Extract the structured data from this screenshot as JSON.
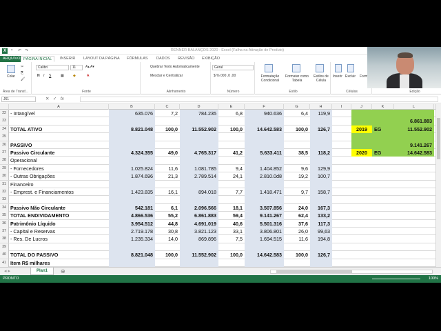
{
  "window": {
    "title": "RENNER BALANÇOS 2020 - Excel (Falha na Ativação de Produto)"
  },
  "ribbon_tabs": [
    "ARQUIVO",
    "PÁGINA INICIAL",
    "INSERIR",
    "LAYOUT DA PÁGINA",
    "FÓRMULAS",
    "DADOS",
    "REVISÃO",
    "EXIBIÇÃO"
  ],
  "ribbon": {
    "paste": "Colar",
    "font_name": "Calibri",
    "font_size": "11",
    "wrap_text": "Quebrar Texto Automaticamente",
    "merge_center": "Mesclar e Centralizar",
    "number_format": "Geral",
    "conditional_format": "Formatação Condicional",
    "format_table": "Formatar como Tabela",
    "cell_styles": "Estilos de Célula",
    "insert": "Inserir",
    "delete": "Excluir",
    "format": "Form",
    "groups": {
      "clipboard": "Área de Transf...",
      "font": "Fonte",
      "alignment": "Alinhamento",
      "number": "Número",
      "styles": "Estilo",
      "cells": "Células",
      "editing": "Edição"
    }
  },
  "formula_bar": {
    "name_box": "J61",
    "fx": "fx",
    "value": ""
  },
  "columns": [
    "A",
    "B",
    "C",
    "D",
    "E",
    "F",
    "G",
    "H",
    "I",
    "J",
    "K",
    "L"
  ],
  "rows": [
    {
      "n": "22",
      "a": " - Intangível",
      "b": "635.076",
      "c": "7,2",
      "d": "784.235",
      "e": "6,8",
      "f": "940.636",
      "g": "6,4",
      "h": "119,9",
      "bold": false
    },
    {
      "n": "23",
      "a": "",
      "b": "",
      "c": "",
      "d": "",
      "e": "",
      "f": "",
      "g": "",
      "h": "",
      "bold": false
    },
    {
      "n": "24",
      "a": "   TOTAL ATIVO",
      "b": "8.821.048",
      "c": "100,0",
      "d": "11.552.902",
      "e": "100,0",
      "f": "14.642.583",
      "g": "100,0",
      "h": "126,7",
      "bold": true
    },
    {
      "n": "25",
      "a": "",
      "b": "",
      "c": "",
      "d": "",
      "e": "",
      "f": "",
      "g": "",
      "h": "",
      "bold": false
    },
    {
      "n": "26",
      "a": "PASSIVO",
      "b": "",
      "c": "",
      "d": "",
      "e": "",
      "f": "",
      "g": "",
      "h": "",
      "bold": true
    },
    {
      "n": "27",
      "a": " Passivo Circulante",
      "b": "4.324.355",
      "c": "49,0",
      "d": "4.765.317",
      "e": "41,2",
      "f": "5.633.411",
      "g": "38,5",
      "h": "118,2",
      "bold": true
    },
    {
      "n": "28",
      "a": "   Operacional",
      "b": "",
      "c": "",
      "d": "",
      "e": "",
      "f": "",
      "g": "",
      "h": "",
      "bold": false
    },
    {
      "n": "29",
      "a": "  - Fornecedores",
      "b": "1.025.824",
      "c": "11,6",
      "d": "1.081.785",
      "e": "9,4",
      "f": "1.404.852",
      "g": "9,6",
      "h": "129,9",
      "bold": false
    },
    {
      "n": "30",
      "a": "  - Outras Obrigações",
      "b": "1.874.696",
      "c": "21,3",
      "d": "2.789.514",
      "e": "24,1",
      "f": "2.810.0d8",
      "g": "19,2",
      "h": "100,7",
      "bold": false
    },
    {
      "n": "31",
      "a": "   Financeiro",
      "b": "",
      "c": "",
      "d": "",
      "e": "",
      "f": "",
      "g": "",
      "h": "",
      "bold": false
    },
    {
      "n": "32",
      "a": "  - Emprest. e Financiamentos",
      "b": "1.423.835",
      "c": "16,1",
      "d": "894.018",
      "e": "7,7",
      "f": "1.418.471",
      "g": "9,7",
      "h": "158,7",
      "bold": false
    },
    {
      "n": "33",
      "a": "",
      "b": "",
      "c": "",
      "d": "",
      "e": "",
      "f": "",
      "g": "",
      "h": "",
      "bold": false
    },
    {
      "n": "34",
      "a": " Passivo Não Circulante",
      "b": "542.181",
      "c": "6,1",
      "d": "2.096.566",
      "e": "18,1",
      "f": "3.507.856",
      "g": "24,0",
      "h": "167,3",
      "bold": true
    },
    {
      "n": "35",
      "a": "  TOTAL ENDIVIDAMENTO",
      "b": "4.866.536",
      "c": "55,2",
      "d": "6.861.883",
      "e": "59,4",
      "f": "9.141.267",
      "g": "62,4",
      "h": "133,2",
      "bold": true
    },
    {
      "n": "36",
      "a": " Patrimônio Líquido",
      "b": "3.954.512",
      "c": "44,8",
      "d": "4.691.019",
      "e": "40,6",
      "f": "5.501.316",
      "g": "37,6",
      "h": "117,3",
      "bold": true
    },
    {
      "n": "37",
      "a": "  - Capital e Reservas",
      "b": "2.719.178",
      "c": "30,8",
      "d": "3.821.123",
      "e": "33,1",
      "f": "3.806.801",
      "g": "26,0",
      "h": "99,63",
      "bold": false
    },
    {
      "n": "38",
      "a": "  - Res. De Lucros",
      "b": "1.235.334",
      "c": "14,0",
      "d": "869.896",
      "e": "7,5",
      "f": "1.694.515",
      "g": "11,6",
      "h": "194,8",
      "bold": false
    },
    {
      "n": "39",
      "a": "",
      "b": "",
      "c": "",
      "d": "",
      "e": "",
      "f": "",
      "g": "",
      "h": "",
      "bold": false
    },
    {
      "n": "40",
      "a": "   TOTAL DO PASSIVO",
      "b": "8.821.048",
      "c": "100,0",
      "d": "11.552.902",
      "e": "100,0",
      "f": "14.642.583",
      "g": "100,0",
      "h": "126,7",
      "bold": true
    },
    {
      "n": "41",
      "a": "Item R$ milhares",
      "b": "",
      "c": "",
      "d": "",
      "e": "",
      "f": "",
      "g": "",
      "h": "",
      "bold": true
    }
  ],
  "side_box": {
    "r24_l": "6.861.883",
    "r25_j": "2019",
    "r25_k": "EG",
    "r25_l": "11.552.902",
    "r27_l": "9.141.267",
    "r28_j": "2020",
    "r28_k": "EG",
    "r28_l": "14.642.583"
  },
  "sheet_tab": "Plan1",
  "add_sheet": "⊕",
  "status": {
    "left": "PRONTO",
    "zoom": "100%"
  },
  "colors": {
    "excel_green": "#217346",
    "shade": "#dde4ef",
    "highlight_green": "#92d050",
    "highlight_yellow": "#ffff00"
  }
}
